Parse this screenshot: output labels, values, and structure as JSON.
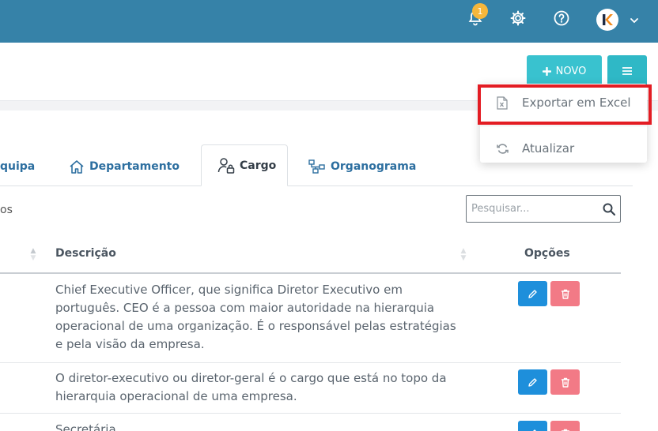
{
  "topbar": {
    "notifications_count": "1",
    "bg_color": "#3682a8",
    "icons": [
      "bell-icon",
      "gear-icon",
      "help-icon",
      "avatar",
      "chevron-down-icon"
    ]
  },
  "actions": {
    "new_label": "NOVO",
    "new_icon": "plus-icon",
    "menu_icon": "hamburger-icon"
  },
  "dropdown": {
    "items": [
      {
        "label": "Exportar em Excel",
        "icon": "excel-file-icon"
      },
      {
        "label": "Atualizar",
        "icon": "refresh-icon"
      }
    ]
  },
  "tabs": [
    {
      "label": "quipa",
      "icon": ""
    },
    {
      "label": "Departamento",
      "icon": "home-icon"
    },
    {
      "label": "Cargo",
      "icon": "user-lock-icon",
      "active": true
    },
    {
      "label": "Organograma",
      "icon": "sitemap-icon"
    }
  ],
  "toolbar": {
    "left_fragment": "os",
    "search_placeholder": "Pesquisar..."
  },
  "table": {
    "headers": [
      "Descrição",
      "Opções"
    ],
    "rows": [
      {
        "description": "Chief Executive Officer, que significa Diretor Executivo em português. CEO é a pessoa com maior autoridade na hierarquia operacional de uma organização. É o responsável pelas estratégias e pela visão da empresa."
      },
      {
        "description": "O diretor-executivo ou diretor-geral é o cargo que está no topo da hierarquia operacional de uma empresa."
      },
      {
        "description": "Secretária"
      }
    ]
  },
  "colors": {
    "accent": "#39c2cf",
    "edit": "#1e8fdb",
    "delete": "#f27a86",
    "highlight": "#e31c23"
  }
}
